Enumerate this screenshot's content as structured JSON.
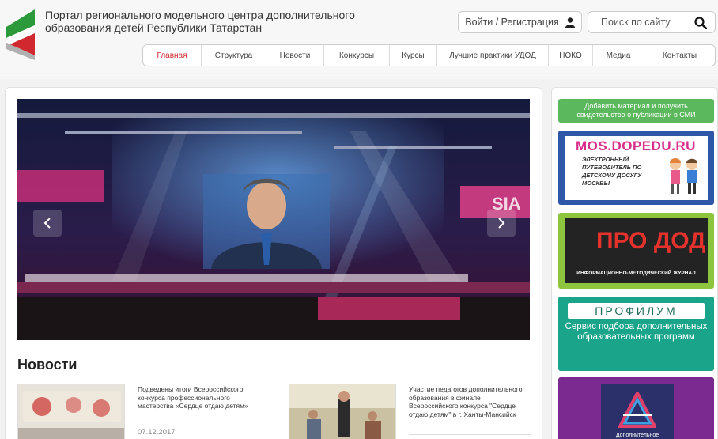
{
  "header": {
    "site_title": "Портал регионального модельного центра дополнительного образования детей Республики Татарстан",
    "login_label": "Войти / Регистрация",
    "search_placeholder": "Поиск по сайту"
  },
  "nav": {
    "items": [
      {
        "label": "Главная",
        "active": true
      },
      {
        "label": "Структура"
      },
      {
        "label": "Новости"
      },
      {
        "label": "Конкурсы"
      },
      {
        "label": "Курсы"
      },
      {
        "label": "Лучшие практики УДОД"
      },
      {
        "label": "НОКО"
      },
      {
        "label": "Медиа"
      },
      {
        "label": "Контакты"
      }
    ]
  },
  "main": {
    "news_heading": "Новости",
    "news": [
      {
        "text": "Подведены итоги Всероссийского конкурса профессионального мастерства «Сердце отдаю детям»",
        "date": "07.12.2017"
      },
      {
        "text": "Участие педагогов дополнительного образования в финале Всероссийского конкурса \"Сердце отдаю детям\" в г. Ханты-Мансийск",
        "date": ""
      }
    ]
  },
  "sidebar": {
    "add_material_label": "Добавить материал и получить свидетельство о публикации в СМИ",
    "banners": {
      "mos_title": "MOS.DOPEDU.RU",
      "mos_sub": "ЭЛЕКТРОННЫЙ ПУТЕВОДИТЕЛЬ ПО ДЕТСКОМУ ДОСУГУ МОСКВЫ",
      "prodod_logo": "ПРО ДОД",
      "prodod_sub": "ИНФОРМАЦИОННО-МЕТОДИЧЕСКИЙ ЖУРНАЛ",
      "profilum_logo": "ПРОФИЛУМ",
      "profilum_sub": "Сервис подбора дополнительных образовательных программ",
      "dop_sub": "Дополнительное"
    }
  },
  "colors": {
    "accent_red": "#d0282e",
    "green_button": "#5cb85c"
  }
}
